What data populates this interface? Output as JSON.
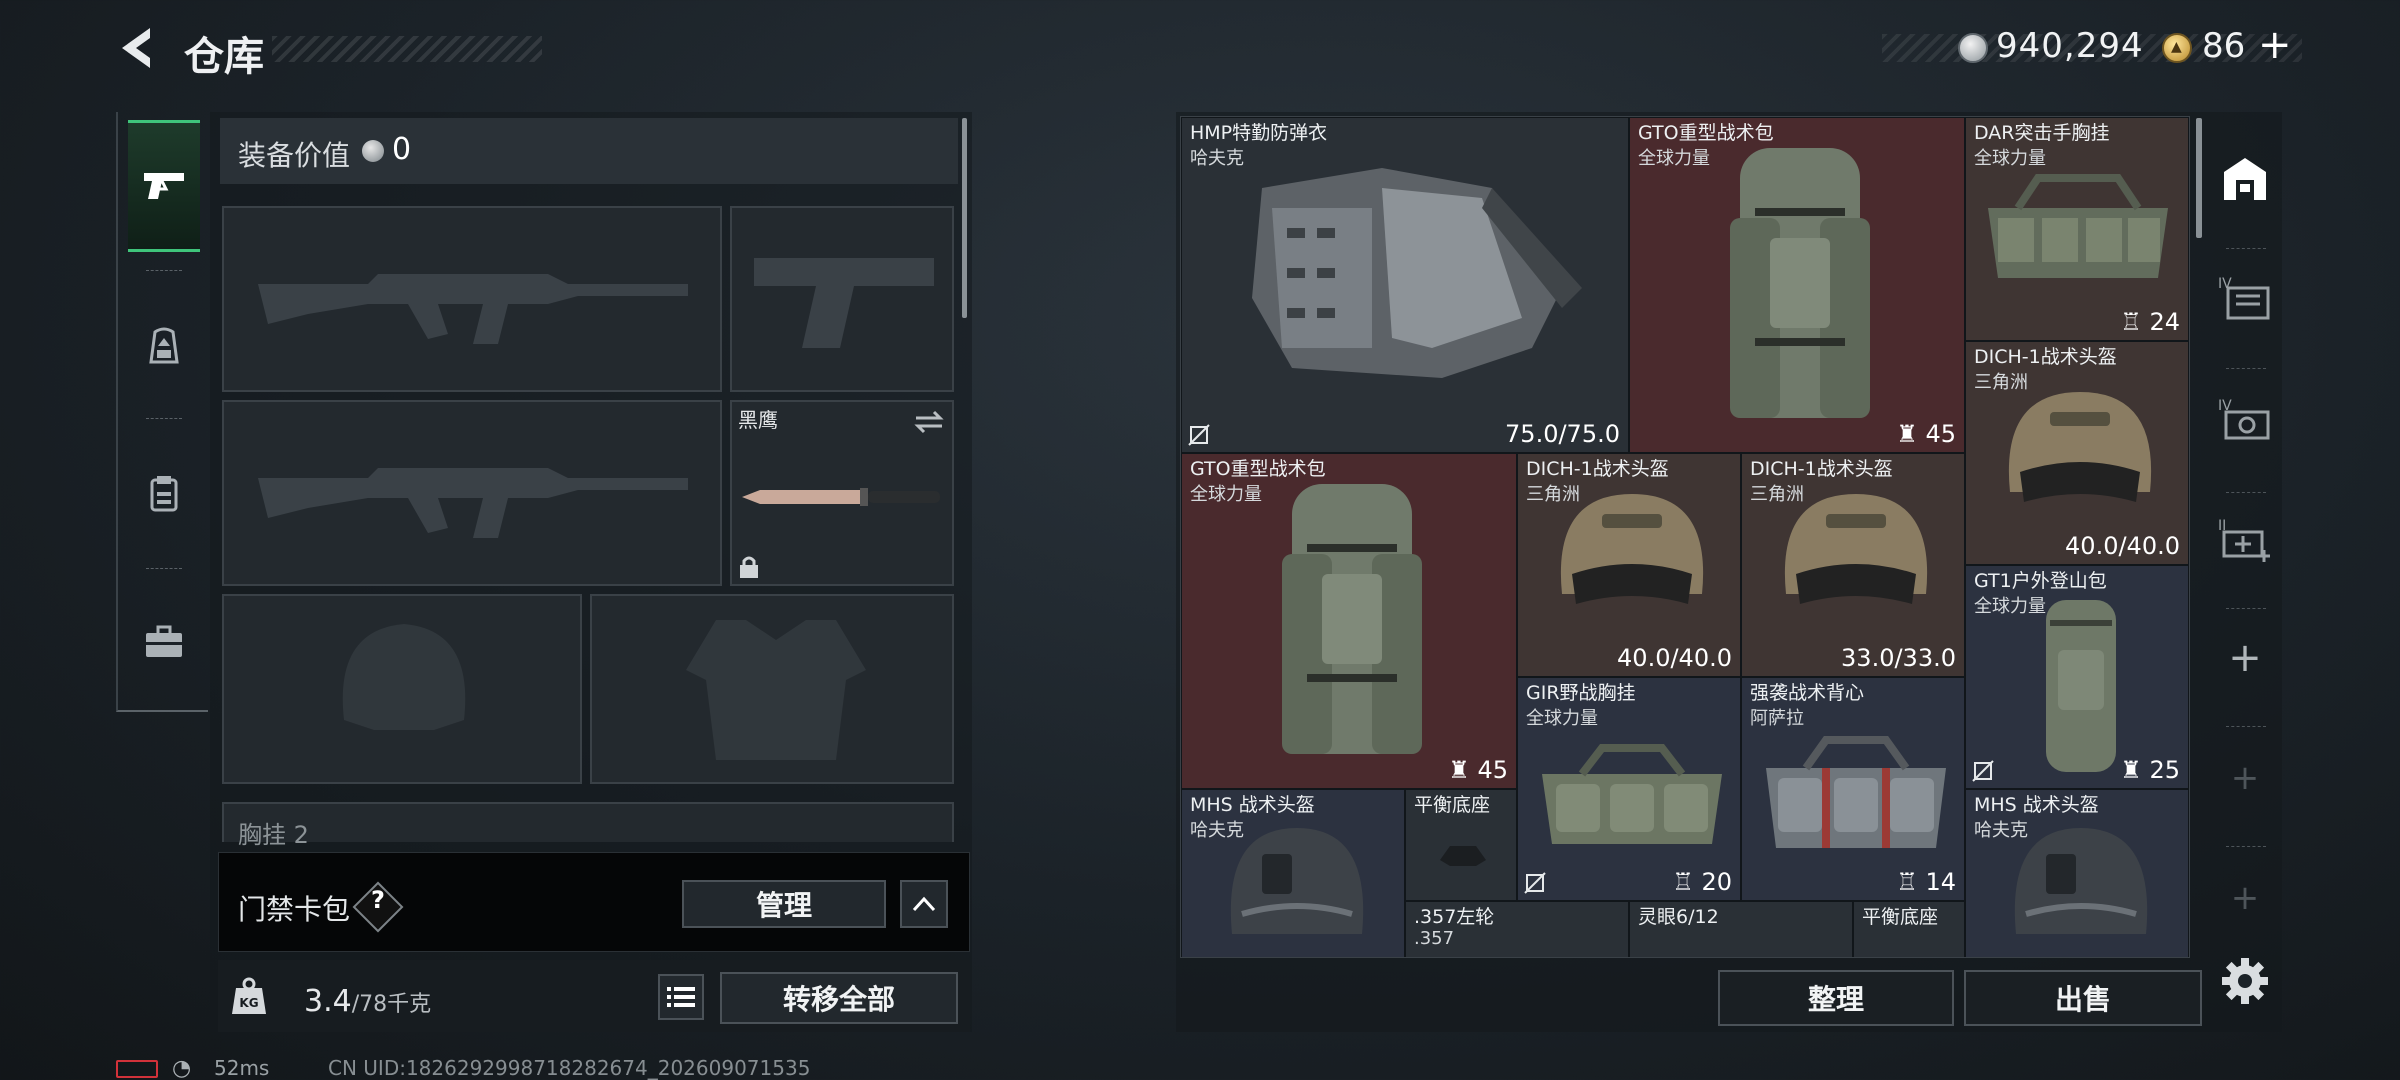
{
  "header": {
    "title": "仓库",
    "money": "940,294",
    "tokens": "86",
    "add_label": "+"
  },
  "left_nav": {
    "items": [
      {
        "name": "nav-weapons",
        "icon": "pistol-icon",
        "active": true
      },
      {
        "name": "nav-backpack",
        "icon": "backpack-icon",
        "active": false
      },
      {
        "name": "nav-vest",
        "icon": "vest-icon",
        "active": false
      },
      {
        "name": "nav-case",
        "icon": "briefcase-icon",
        "active": false
      }
    ]
  },
  "equipment": {
    "value_label": "装备价值",
    "value": "0",
    "knife_name": "黑鹰",
    "partial_label": "胸挂 2"
  },
  "keycard": {
    "label": "门禁卡包",
    "help": "?",
    "manage": "管理"
  },
  "weight": {
    "current": "3.4",
    "max": "/78千克",
    "transfer_all": "转移全部"
  },
  "status": {
    "ping": "52ms",
    "uid": "CN UID:1826292998718282674_202609071535"
  },
  "items": [
    {
      "name": "HMP特勤防弹衣",
      "brand": "哈夫克",
      "value": "75.0/75.0"
    },
    {
      "name": "GTO重型战术包",
      "brand": "全球力量",
      "value": "45"
    },
    {
      "name": "DAR突击手胸挂",
      "brand": "全球力量",
      "value": "24"
    },
    {
      "name": "DICH-1战术头盔",
      "brand": "三角洲",
      "value": "40.0/40.0"
    },
    {
      "name": "GTO重型战术包",
      "brand": "全球力量",
      "value": "45"
    },
    {
      "name": "DICH-1战术头盔",
      "brand": "三角洲",
      "value": "40.0/40.0"
    },
    {
      "name": "DICH-1战术头盔",
      "brand": "三角洲",
      "value": "33.0/33.0"
    },
    {
      "name": "GT1户外登山包",
      "brand": "全球力量",
      "value": "25"
    },
    {
      "name": "GIR野战胸挂",
      "brand": "全球力量",
      "value": "20"
    },
    {
      "name": "强袭战术背心",
      "brand": "阿萨拉",
      "value": "14"
    },
    {
      "name": "MHS 战术头盔",
      "brand": "哈夫克"
    },
    {
      "name": "平衡底座"
    },
    {
      "name": ".357左轮",
      "brand": ".357"
    },
    {
      "name": "灵眼6/12"
    },
    {
      "name": "平衡底座"
    },
    {
      "name": "MHS 战术头盔",
      "brand": "哈夫克"
    }
  ],
  "actions": {
    "sort": "整理",
    "sell": "出售",
    "add": "+"
  },
  "colors": {
    "accent_green": "#3fc57b",
    "rarity_red": "#4a2a2d",
    "rarity_blue": "#2c3240",
    "rarity_brown": "#3f3533"
  }
}
